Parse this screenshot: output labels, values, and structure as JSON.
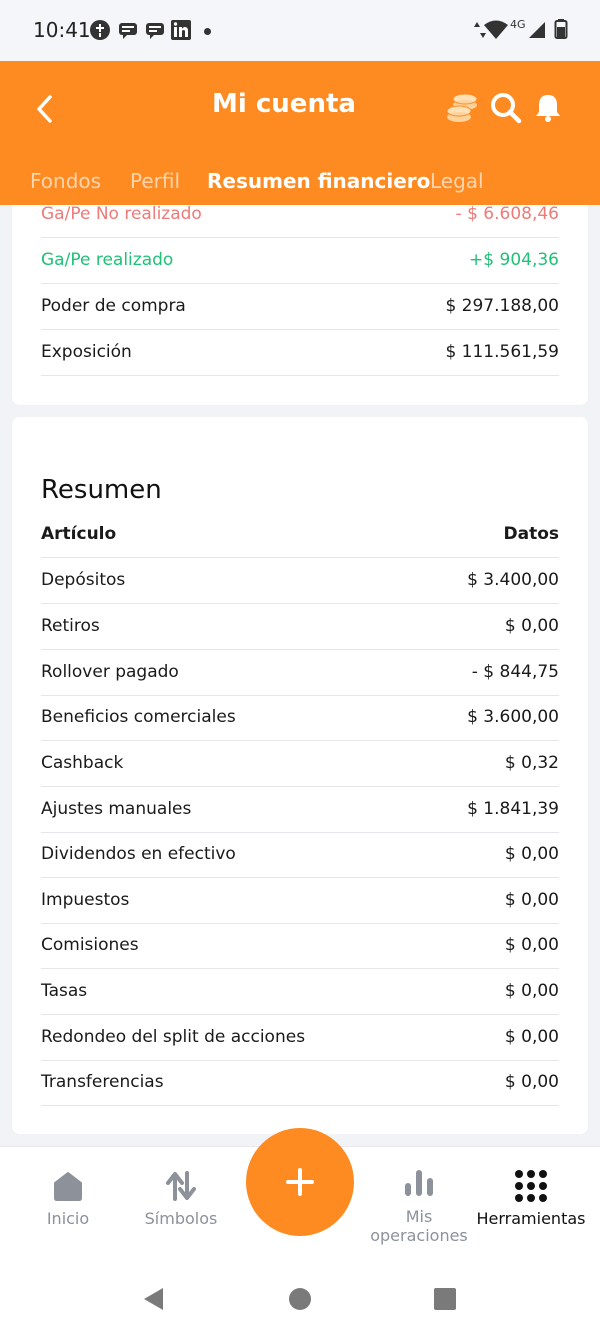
{
  "status_bar": {
    "time": "10:41",
    "network": "4G",
    "icons": [
      "alert-icon",
      "message-icon",
      "message-icon",
      "linkedin-icon",
      "wifi-icon",
      "signal-icon",
      "battery-icon"
    ]
  },
  "header": {
    "title": "Mi cuenta",
    "icons": [
      "back-icon",
      "coins-icon",
      "search-icon",
      "bell-icon"
    ],
    "tabs": [
      {
        "label": "Fondos"
      },
      {
        "label": "Perfil"
      },
      {
        "label": "Resumen financiero",
        "active": true
      },
      {
        "label": "Legal"
      }
    ],
    "accent_color": "#fe8a22"
  },
  "account_card": {
    "rows": [
      {
        "label": "Ga/Pe No realizado",
        "value": "- $ 6.608,46",
        "tone": "negative"
      },
      {
        "label": "Ga/Pe realizado",
        "value": "+$ 904,36",
        "tone": "positive"
      },
      {
        "label": "Poder de compra",
        "value": "$ 297.188,00"
      },
      {
        "label": "Exposición",
        "value": "$ 111.561,59"
      }
    ]
  },
  "summary": {
    "title": "Resumen",
    "column_item": "Artículo",
    "column_data": "Datos",
    "rows": [
      {
        "label": "Depósitos",
        "value": "$ 3.400,00"
      },
      {
        "label": "Retiros",
        "value": "$ 0,00"
      },
      {
        "label": "Rollover pagado",
        "value": "- $ 844,75"
      },
      {
        "label": "Beneficios comerciales",
        "value": "$ 3.600,00"
      },
      {
        "label": "Cashback",
        "value": "$ 0,32"
      },
      {
        "label": "Ajustes manuales",
        "value": "$ 1.841,39"
      },
      {
        "label": "Dividendos en efectivo",
        "value": "$ 0,00"
      },
      {
        "label": "Impuestos",
        "value": "$ 0,00"
      },
      {
        "label": "Comisiones",
        "value": "$ 0,00"
      },
      {
        "label": "Tasas",
        "value": "$ 0,00"
      },
      {
        "label": "Redondeo del split de acciones",
        "value": "$ 0,00"
      },
      {
        "label": "Transferencias",
        "value": "$ 0,00"
      }
    ]
  },
  "bottom_nav": {
    "items": [
      {
        "label": "Inicio",
        "icon": "home-icon"
      },
      {
        "label": "Símbolos",
        "icon": "swap-arrows-icon"
      },
      {
        "label": "Mis operaciones",
        "icon": "bar-chart-icon"
      },
      {
        "label": "Herramientas",
        "icon": "grid-dots-icon"
      }
    ],
    "fab_icon": "plus-icon"
  }
}
